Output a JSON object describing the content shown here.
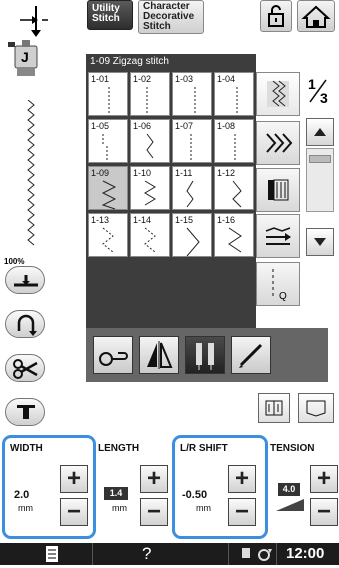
{
  "header": {
    "tab_utility": "Utility\nStitch",
    "tab_utility_lines": [
      "Utility",
      "Stitch"
    ],
    "tab_character_lines": [
      "Character",
      "Decorative",
      "Stitch"
    ]
  },
  "left": {
    "presser_foot_letter": "J",
    "zoom": "100%"
  },
  "panel": {
    "title": "1-09  Zigzag stitch",
    "cells": [
      "1-01",
      "1-02",
      "1-03",
      "1-04",
      "1-05",
      "1-06",
      "1-07",
      "1-08",
      "1-09",
      "1-10",
      "1-11",
      "1-12",
      "1-13",
      "1-14",
      "1-15",
      "1-16"
    ],
    "selected": "1-09",
    "page_num": "1",
    "page_den": "3"
  },
  "settings": {
    "width_label": "WIDTH",
    "width_value": "2.0",
    "width_unit": "mm",
    "length_label": "LENGTH",
    "length_value": "1.4",
    "length_unit": "mm",
    "lr_label": "L/R SHIFT",
    "lr_value": "-0.50",
    "lr_unit": "mm",
    "tension_label": "TENSION",
    "tension_value": "4.0"
  },
  "footer": {
    "help": "?",
    "time": "12:00"
  }
}
